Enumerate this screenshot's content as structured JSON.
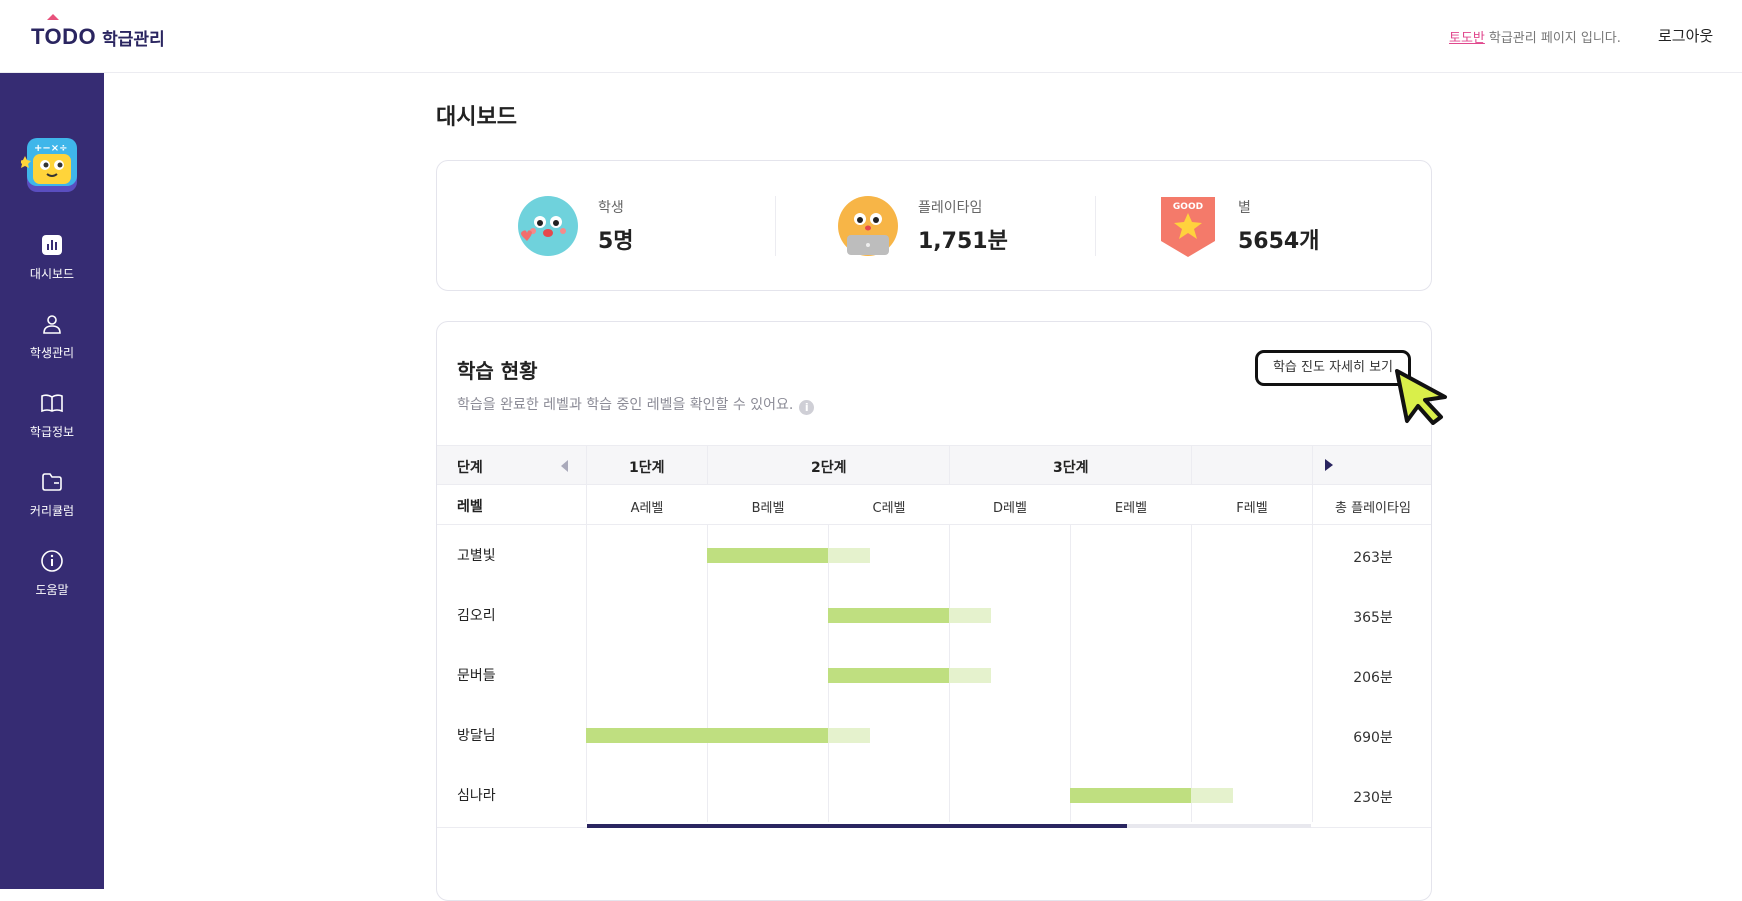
{
  "header": {
    "logo_mark": "TODO",
    "logo_sub": "학급관리",
    "class_name": "토도반",
    "notice": "학급관리 페이지 입니다.",
    "logout": "로그아웃"
  },
  "sidebar": {
    "items": [
      {
        "label": "대시보드",
        "icon": "bar-chart-icon",
        "active": true
      },
      {
        "label": "학생관리",
        "icon": "user-icon"
      },
      {
        "label": "학급정보",
        "icon": "book-icon"
      },
      {
        "label": "커리큘럼",
        "icon": "folder-icon"
      },
      {
        "label": "도움말",
        "icon": "info-icon"
      }
    ]
  },
  "main": {
    "title": "대시보드",
    "stats": [
      {
        "label": "학생",
        "value": "5명",
        "icon": "student-face-icon"
      },
      {
        "label": "플레이타임",
        "value": "1,751분",
        "icon": "laptop-face-icon"
      },
      {
        "label": "별",
        "value": "5654개",
        "icon": "good-star-badge-icon",
        "badge_text": "GOOD"
      }
    ],
    "progress": {
      "title": "학습 현황",
      "description": "학습을 완료한 레벨과 학습 중인 레벨을 확인할 수 있어요.",
      "detail_button": "학습 진도 자세히 보기",
      "stage_header": "단계",
      "level_header": "레벨",
      "stages": [
        "1단계",
        "2단계",
        "3단계"
      ],
      "levels": [
        "A레벨",
        "B레벨",
        "C레벨",
        "D레벨",
        "E레벨",
        "F레벨"
      ],
      "total_header": "총 플레이타임",
      "students": [
        {
          "name": "고별빛",
          "done_from": 1,
          "done_to": 2,
          "in_progress": 0.35,
          "time": "263분"
        },
        {
          "name": "김오리",
          "done_from": 2,
          "done_to": 3,
          "in_progress": 0.35,
          "time": "365분"
        },
        {
          "name": "문버들",
          "done_from": 2,
          "done_to": 3,
          "in_progress": 0.35,
          "time": "206분"
        },
        {
          "name": "방달님",
          "done_from": 0,
          "done_to": 2,
          "in_progress": 0.35,
          "time": "690분"
        },
        {
          "name": "심나라",
          "done_from": 4,
          "done_to": 5,
          "in_progress": 0.35,
          "time": "230분"
        }
      ]
    }
  },
  "colors": {
    "sidebar": "#362c73",
    "accent": "#e0478d",
    "bar_done": "#bfdf80",
    "bar_progress": "#e5f2cd"
  }
}
